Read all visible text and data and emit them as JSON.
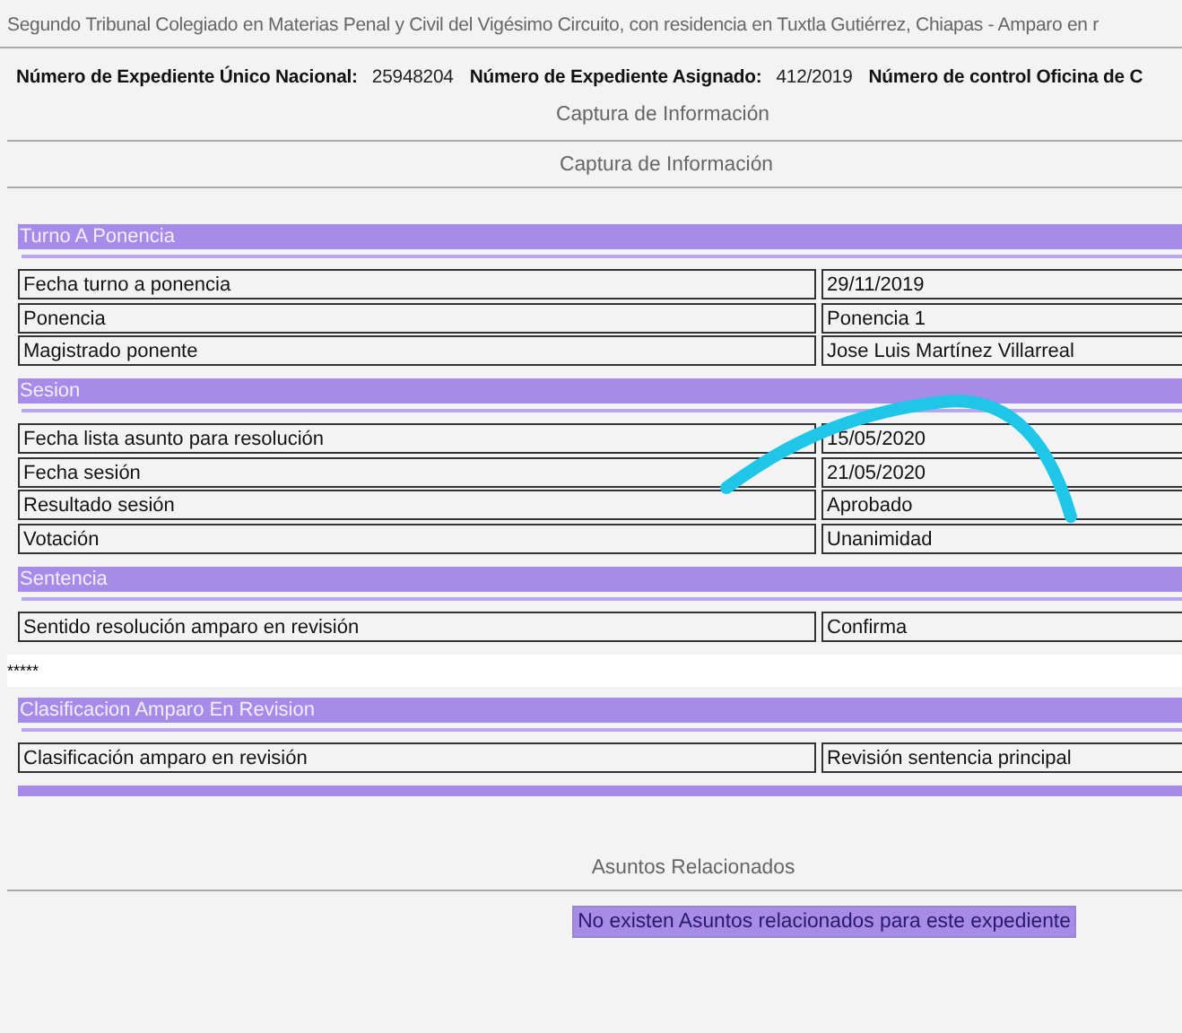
{
  "title": "Segundo Tribunal Colegiado en Materias Penal y Civil del Vigésimo Circuito, con residencia en Tuxtla Gutiérrez, Chiapas - Amparo en r",
  "info": [
    {
      "label": "Número de Expediente Único Nacional:",
      "value": "25948204"
    },
    {
      "label": "Número de Expediente Asignado:",
      "value": "412/2019"
    },
    {
      "label": "Número de control Oficina de C"
    }
  ],
  "captions": [
    "Captura de Información",
    "Captura de Información"
  ],
  "sections": [
    {
      "kind": "table",
      "header": "Turno A Ponencia",
      "rows": [
        {
          "label": "Fecha turno a ponencia",
          "value": "29/11/2019"
        },
        {
          "label": "Ponencia",
          "value": "Ponencia 1"
        },
        {
          "label": "Magistrado ponente",
          "value": "Jose Luis Martínez Villarreal"
        }
      ]
    },
    {
      "kind": "table",
      "header": "Sesion",
      "rows": [
        {
          "label": "Fecha lista asunto para resolución",
          "value": "15/05/2020"
        },
        {
          "label": "Fecha sesión",
          "value": "21/05/2020"
        },
        {
          "label": "Resultado sesión",
          "value": "Aprobado"
        },
        {
          "label": "Votación",
          "value": "Unanimidad"
        }
      ]
    },
    {
      "kind": "table",
      "header": "Sentencia",
      "rows": [
        {
          "label": "Sentido resolución amparo en revisión",
          "value": "Confirma"
        }
      ]
    },
    {
      "kind": "note",
      "text": "*****"
    },
    {
      "kind": "table",
      "header": "Clasificacion Amparo En Revision",
      "rows": [
        {
          "label": "Clasificación amparo en revisión",
          "value": "Revisión sentencia principal"
        }
      ]
    },
    {
      "kind": "cut_header"
    }
  ],
  "related": {
    "title": "Asuntos Relacionados",
    "message": "No existen Asuntos relacionados para este expediente"
  }
}
